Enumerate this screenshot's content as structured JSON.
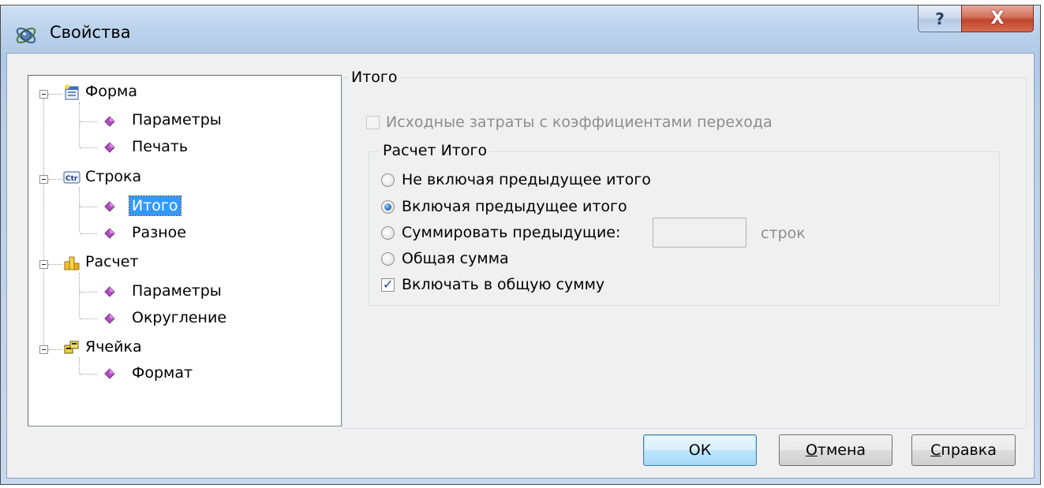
{
  "window": {
    "title": "Свойства",
    "help_glyph": "?",
    "close_glyph": "X"
  },
  "tree": {
    "nodes": [
      {
        "label": "Форма",
        "icon": "form-icon",
        "children": [
          {
            "label": "Параметры"
          },
          {
            "label": "Печать"
          }
        ]
      },
      {
        "label": "Строка",
        "icon": "row-icon",
        "children": [
          {
            "label": "Итого",
            "selected": true
          },
          {
            "label": "Разное"
          }
        ]
      },
      {
        "label": "Расчет",
        "icon": "calc-icon",
        "children": [
          {
            "label": "Параметры"
          },
          {
            "label": "Округление"
          }
        ]
      },
      {
        "label": "Ячейка",
        "icon": "cell-icon",
        "children": [
          {
            "label": "Формат"
          }
        ]
      }
    ]
  },
  "panel": {
    "group_title": "Итого",
    "source_costs_checkbox": {
      "label": "Исходные затраты с коэффициентами перехода",
      "checked": false,
      "enabled": false
    },
    "calc_group": {
      "title": "Расчет Итого",
      "options": [
        {
          "label": "Не включая предыдущее итого",
          "checked": false
        },
        {
          "label": "Включая предыдущее итого",
          "checked": true
        },
        {
          "label": "Суммировать предыдущие:",
          "checked": false
        },
        {
          "label": "Общая сумма",
          "checked": false
        }
      ],
      "rows_input_value": "",
      "rows_suffix": "строк",
      "include_total_checkbox": {
        "label": "Включать в общую сумму",
        "checked": true
      }
    }
  },
  "buttons": {
    "ok": "ОК",
    "cancel_first": "О",
    "cancel_rest": "тмена",
    "help_first": "С",
    "help_rest": "правка"
  },
  "colors": {
    "selection": "#3399ff",
    "title_gradient": "#bcd3ec",
    "close_button": "#c0452b"
  }
}
